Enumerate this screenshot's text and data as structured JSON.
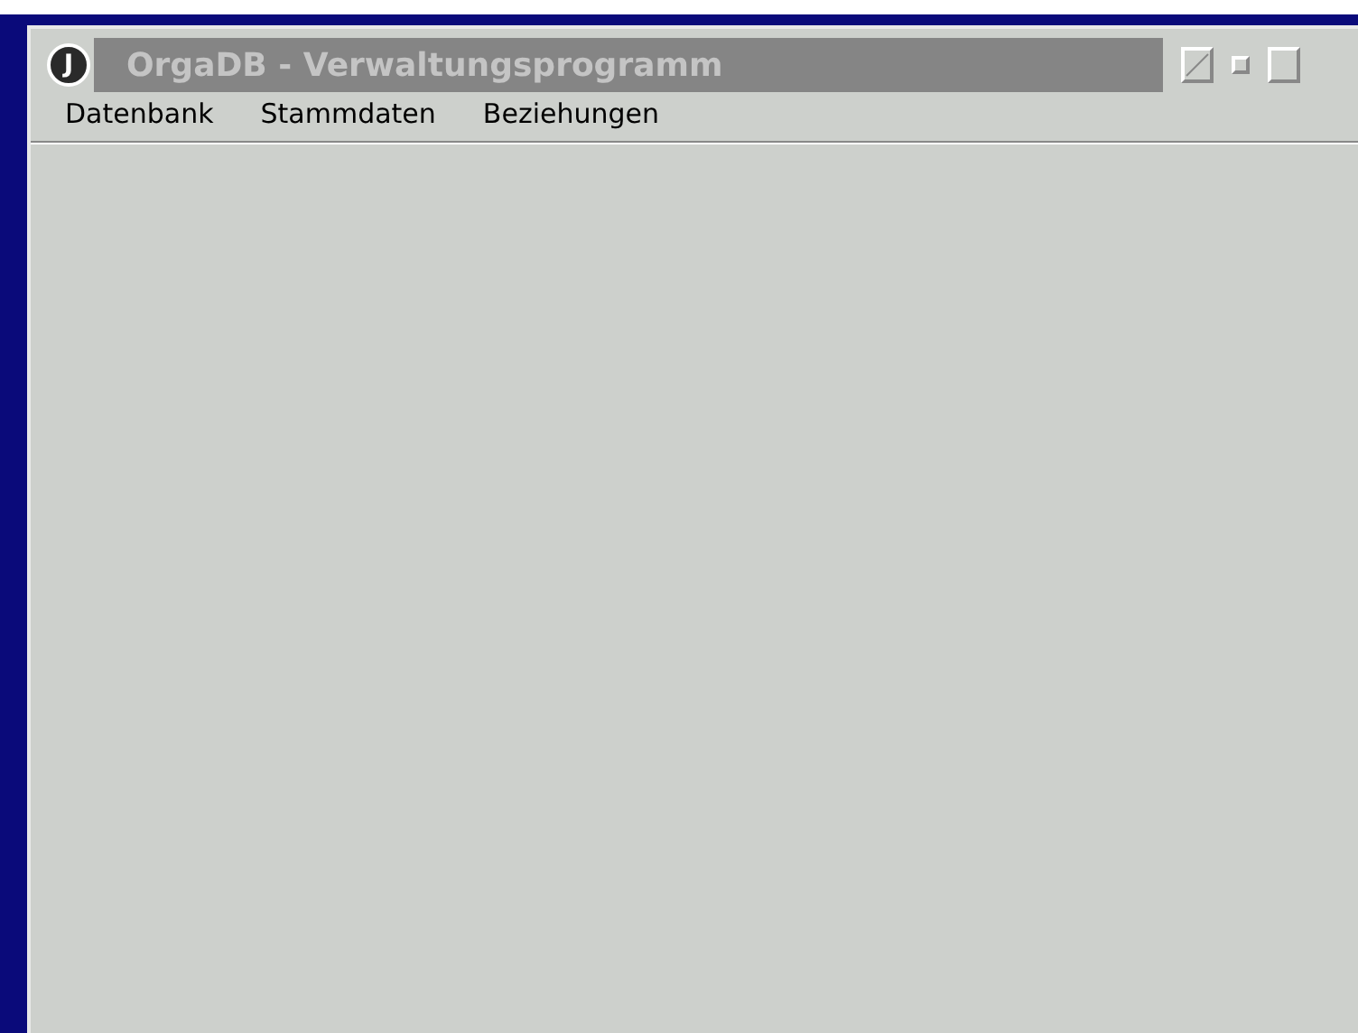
{
  "window": {
    "title": "OrgaDB - Verwaltungsprogramm",
    "icon_letter": "J",
    "active": false
  },
  "menu": [
    {
      "label": "Datenbank"
    },
    {
      "label": "Stammdaten"
    },
    {
      "label": "Beziehungen"
    }
  ]
}
